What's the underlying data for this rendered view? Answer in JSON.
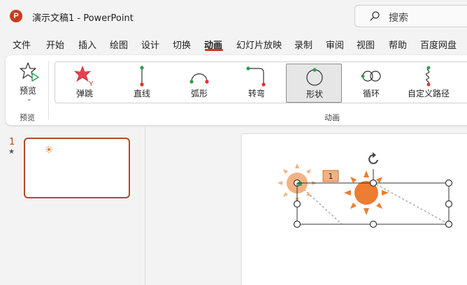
{
  "window": {
    "app_icon_letter": "P",
    "title": "演示文稿1  -  PowerPoint"
  },
  "search": {
    "placeholder": "搜索"
  },
  "menu": {
    "tabs": [
      {
        "label": "文件"
      },
      {
        "label": "开始"
      },
      {
        "label": "插入"
      },
      {
        "label": "绘图"
      },
      {
        "label": "设计"
      },
      {
        "label": "切换"
      },
      {
        "label": "动画",
        "active": true
      },
      {
        "label": "幻灯片放映"
      },
      {
        "label": "录制"
      },
      {
        "label": "审阅"
      },
      {
        "label": "视图"
      },
      {
        "label": "帮助"
      },
      {
        "label": "百度网盘"
      }
    ]
  },
  "ribbon": {
    "preview": {
      "button_label": "预览",
      "group_label": "预览",
      "icon": "preview-star-icon"
    },
    "animation": {
      "group_label": "动画",
      "selected": "形状",
      "items": [
        {
          "label": "弹跳",
          "icon": "bounce-icon"
        },
        {
          "label": "直线",
          "icon": "line-path-icon"
        },
        {
          "label": "弧形",
          "icon": "arc-path-icon"
        },
        {
          "label": "转弯",
          "icon": "turn-path-icon"
        },
        {
          "label": "形状",
          "icon": "shape-path-icon"
        },
        {
          "label": "循环",
          "icon": "loop-path-icon"
        },
        {
          "label": "自定义路径",
          "icon": "custom-path-icon"
        }
      ]
    }
  },
  "slides": {
    "items": [
      {
        "number": "1",
        "has_animation": true
      }
    ]
  },
  "canvas": {
    "animation_tag": "1",
    "colors": {
      "sun_start": "#f4b183",
      "sun_end": "#ed7d31",
      "accent": "#c43e1c"
    }
  }
}
